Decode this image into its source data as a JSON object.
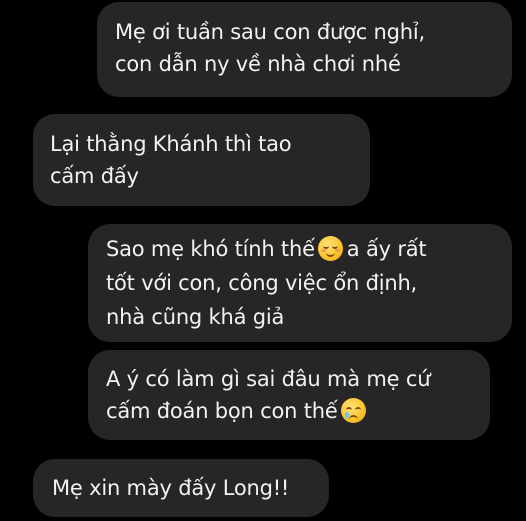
{
  "messages": [
    {
      "sender": "me",
      "lines": [
        "Mẹ ơi tuần sau con được nghỉ,",
        "con dẫn ny về nhà chơi nhé"
      ]
    },
    {
      "sender": "mom",
      "lines": [
        "Lại thằng Khánh thì tao",
        "cấm đấy"
      ]
    },
    {
      "sender": "me",
      "lines": [
        "Sao mẹ khó tính thế",
        "a ấy rất",
        "tốt với con, công việc ổn định,",
        "nhà cũng khá giả"
      ],
      "emoji": "relieved-face-icon"
    },
    {
      "sender": "me",
      "lines": [
        "A ý có làm gì sai đâu mà mẹ cứ",
        "cấm đoán bọn con thế"
      ],
      "emoji": "face-holding-back-tears-icon"
    },
    {
      "sender": "mom",
      "lines": [
        "Mẹ xin mày đấy Long!!"
      ]
    }
  ],
  "colors": {
    "background": "#000000",
    "bubble": "#262629",
    "text": "#f2f2f2"
  }
}
